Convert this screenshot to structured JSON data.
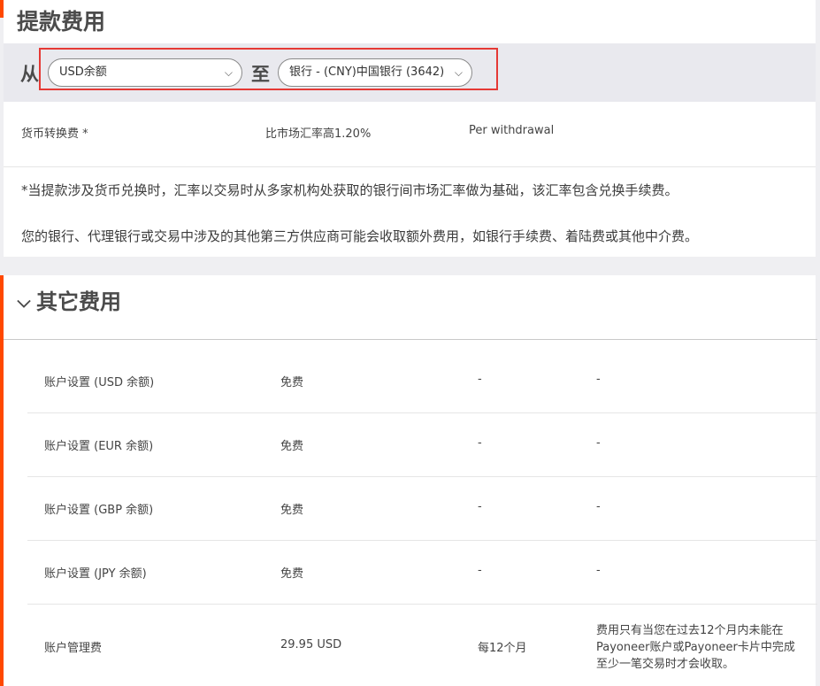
{
  "withdrawal": {
    "title": "提款费用",
    "from_label": "从",
    "from_value": "USD余额",
    "to_label": "至",
    "to_value": "银行 - (CNY)中国银行 (3642)",
    "fee": {
      "name": "货币转换费 *",
      "rate": "比市场汇率高1.20%",
      "frequency": "Per withdrawal"
    },
    "notes": [
      "*当提款涉及货币兑换时，汇率以交易时从多家机构处获取的银行间市场汇率做为基础，该汇率包含兑换手续费。",
      "您的银行、代理银行或交易中涉及的其他第三方供应商可能会收取额外费用，如银行手续费、着陆费或其他中介费。"
    ]
  },
  "other_fees": {
    "title": "其它费用",
    "rows": [
      {
        "name": "账户设置 (USD 余额)",
        "amount": "免费",
        "frequency": "-",
        "note": "-"
      },
      {
        "name": "账户设置 (EUR 余额)",
        "amount": "免费",
        "frequency": "-",
        "note": "-"
      },
      {
        "name": "账户设置 (GBP 余额)",
        "amount": "免费",
        "frequency": "-",
        "note": "-"
      },
      {
        "name": "账户设置 (JPY 余额)",
        "amount": "免费",
        "frequency": "-",
        "note": "-"
      },
      {
        "name": "账户管理费",
        "amount": "29.95 USD",
        "frequency": "每12个月",
        "note": "费用只有当您在过去12个月内未能在Payoneer账户或Payoneer卡片中完成至少一笔交易时才会收取。"
      }
    ]
  },
  "colors": {
    "accent": "#ff4800",
    "highlight_border": "#e53935"
  }
}
